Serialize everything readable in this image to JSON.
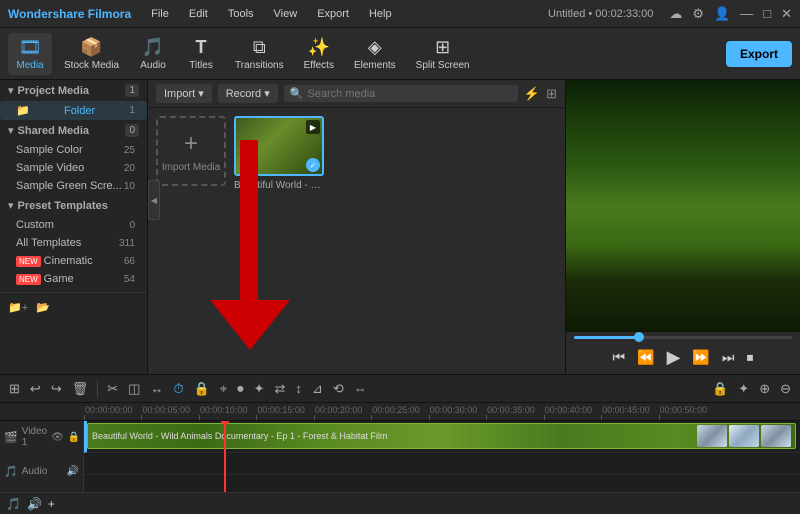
{
  "app": {
    "logo": "Wondershare Filmora",
    "title": "Untitled • 00:02:33:00",
    "menu_items": [
      "File",
      "Edit",
      "Tools",
      "View",
      "Export",
      "Help"
    ]
  },
  "toolbar": {
    "tools": [
      {
        "id": "media",
        "icon": "🎞",
        "label": "Media",
        "active": true
      },
      {
        "id": "stock",
        "icon": "📦",
        "label": "Stock Media",
        "active": false
      },
      {
        "id": "audio",
        "icon": "🎵",
        "label": "Audio",
        "active": false
      },
      {
        "id": "titles",
        "icon": "T",
        "label": "Titles",
        "active": false
      },
      {
        "id": "transitions",
        "icon": "⧉",
        "label": "Transitions",
        "active": false
      },
      {
        "id": "effects",
        "icon": "✨",
        "label": "Effects",
        "active": false
      },
      {
        "id": "elements",
        "icon": "◈",
        "label": "Elements",
        "active": false
      },
      {
        "id": "split",
        "icon": "⊞",
        "label": "Split Screen",
        "active": false
      }
    ],
    "export_label": "Export"
  },
  "sidebar": {
    "sections": [
      {
        "label": "Project Media",
        "count": "1",
        "items": [
          {
            "label": "Folder",
            "count": "1",
            "active": true
          }
        ]
      },
      {
        "label": "Shared Media",
        "count": "0",
        "items": [
          {
            "label": "Sample Color",
            "count": "25"
          },
          {
            "label": "Sample Video",
            "count": "20"
          },
          {
            "label": "Sample Green Scre...",
            "count": "10"
          }
        ]
      },
      {
        "label": "Preset Templates",
        "count": "",
        "items": [
          {
            "label": "Custom",
            "count": "0"
          },
          {
            "label": "All Templates",
            "count": "311"
          },
          {
            "label": "Cinematic",
            "count": "66",
            "badge": "NEW"
          },
          {
            "label": "Game",
            "count": "54",
            "badge": "NEW"
          }
        ]
      }
    ]
  },
  "media_panel": {
    "import_label": "Import",
    "record_label": "Record",
    "search_placeholder": "Search media",
    "import_media_label": "Import Media",
    "media_items": [
      {
        "name": "Beautiful World - Wild A...",
        "has_check": true
      }
    ]
  },
  "preview": {
    "progress_pct": 30,
    "controls": [
      "⏮",
      "⏪",
      "▶",
      "⏩",
      "⏭",
      "⏹"
    ]
  },
  "timeline": {
    "ruler_marks": [
      "00:00:00:00",
      "00:00:05:00",
      "00:00:10:00",
      "00:00:15:00",
      "00:00:20:00",
      "00:00:25:00",
      "00:00:30:00",
      "00:00:35:00",
      "00:00:40:00",
      "00:00:45:00",
      "00:00:50:00"
    ],
    "clip_label": "Beautiful World - Wild Animals Documentary - Ep 1 - Forest & Habitat Film",
    "toolbar_btns": [
      "⊞",
      "↩",
      "↪",
      "🗑",
      "✂",
      "♦",
      "↔",
      "T",
      "⏱",
      "🔒",
      "⌖",
      "⏺",
      "✦",
      "⇄",
      "↕",
      "⊿",
      "⟲",
      "⇔"
    ],
    "right_btns": [
      "🔒",
      "✦",
      "⊕",
      "⇔"
    ]
  }
}
